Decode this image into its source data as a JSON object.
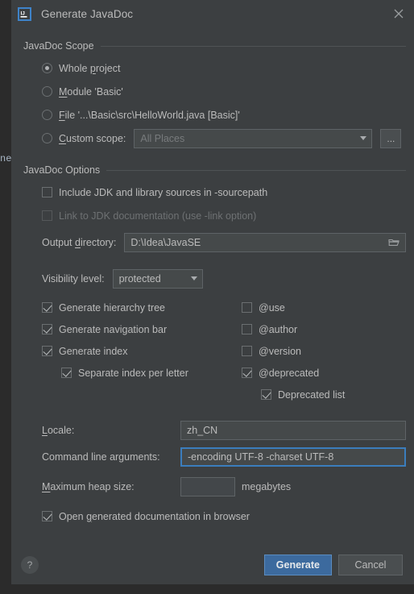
{
  "window": {
    "title": "Generate JavaDoc",
    "app_icon": "intellij-idea-icon",
    "close_icon": "close-icon",
    "backdrop_text": "ne"
  },
  "scope_section": {
    "legend": "JavaDoc Scope",
    "options": [
      {
        "label": "Whole project",
        "mnemonic": "p",
        "selected": true
      },
      {
        "label": "Module 'Basic'",
        "mnemonic": "M",
        "selected": false
      },
      {
        "label": "File '...\\Basic\\src\\HelloWorld.java [Basic]'",
        "mnemonic": "F",
        "selected": false
      },
      {
        "label": "Custom scope:",
        "mnemonic": "C",
        "selected": false
      }
    ],
    "custom_scope": {
      "value": "All Places",
      "is_placeholder": true,
      "browse_label": "...",
      "caret_icon": "chevron-down-icon"
    }
  },
  "options_section": {
    "legend": "JavaDoc Options",
    "include_jdk": {
      "label": "Include JDK and library sources in -sourcepath",
      "checked": false,
      "disabled": false
    },
    "link_jdk": {
      "label": "Link to JDK documentation (use -link option)",
      "checked": false,
      "disabled": true
    },
    "output_directory": {
      "label": "Output directory:",
      "mnemonic": "d",
      "value": "D:\\Idea\\JavaSE",
      "browse_icon": "folder-icon"
    },
    "visibility": {
      "label": "Visibility level:",
      "value": "protected",
      "caret_icon": "chevron-down-icon"
    },
    "left_checks": [
      {
        "label": "Generate hierarchy tree",
        "checked": true,
        "indent": false
      },
      {
        "label": "Generate navigation bar",
        "checked": true,
        "indent": false
      },
      {
        "label": "Generate index",
        "checked": true,
        "indent": false
      },
      {
        "label": "Separate index per letter",
        "checked": true,
        "indent": true
      }
    ],
    "right_checks": [
      {
        "label": "@use",
        "checked": false,
        "indent": false
      },
      {
        "label": "@author",
        "checked": false,
        "indent": false
      },
      {
        "label": "@version",
        "checked": false,
        "indent": false
      },
      {
        "label": "@deprecated",
        "checked": true,
        "indent": false
      },
      {
        "label": "Deprecated list",
        "checked": true,
        "indent": true
      }
    ],
    "locale": {
      "label": "Locale:",
      "mnemonic": "L",
      "value": "zh_CN"
    },
    "command_line": {
      "label": "Command line arguments:",
      "value": "-encoding UTF-8 -charset UTF-8",
      "focused": true
    },
    "heap_size": {
      "label": "Maximum heap size:",
      "mnemonic": "M",
      "value": "",
      "unit": "megabytes"
    },
    "open_in_browser": {
      "label": "Open generated documentation in browser",
      "mnemonic": "g",
      "checked": true
    }
  },
  "footer": {
    "help_label": "?",
    "generate_label": "Generate",
    "cancel_label": "Cancel"
  },
  "colors": {
    "dialog_bg": "#3c3f41",
    "backdrop_bg": "#2b2b2b",
    "text": "#bbbbbb",
    "disabled_text": "#6e7173",
    "field_bg": "#45494a",
    "border": "#5e6366",
    "accent": "#3c6a9e",
    "focus_border": "#3b7dbd"
  }
}
